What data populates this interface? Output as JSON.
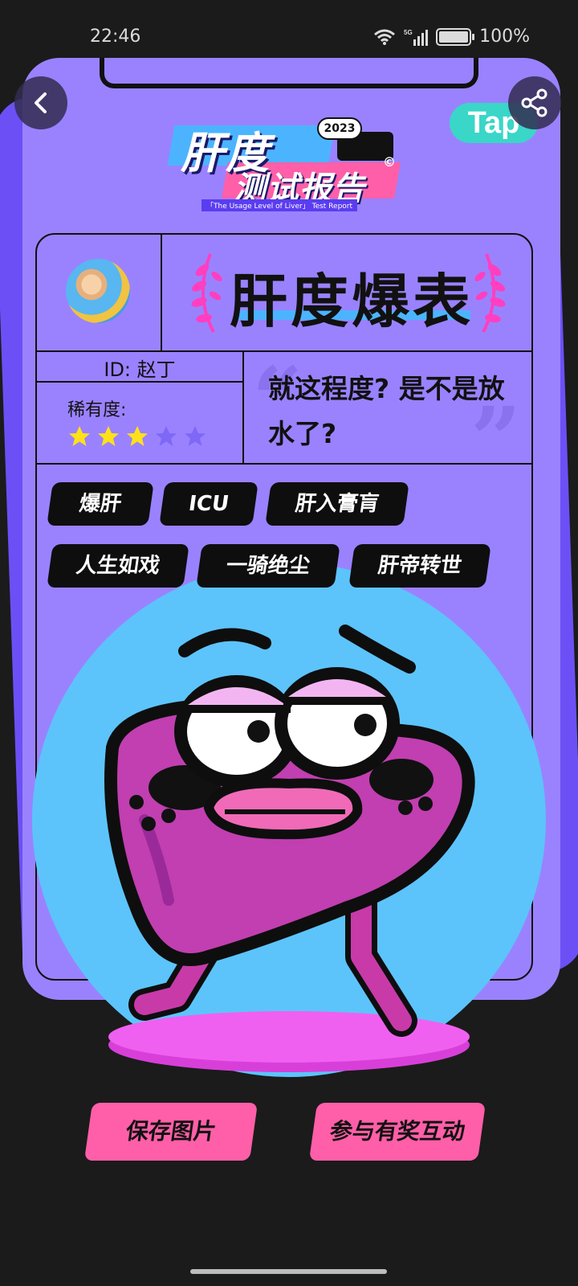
{
  "status_bar": {
    "time": "22:46",
    "battery_text": "100%",
    "network": "5G"
  },
  "header": {
    "back_icon": "chevron-left-icon",
    "share_icon": "share-icon",
    "tap_badge": "Tap"
  },
  "logo": {
    "line1": "肝度",
    "line2": "测试报告",
    "year": "2023",
    "subtitle": "「The Usage Level of Liver」 Test Report",
    "copyright": "©"
  },
  "profile": {
    "level_title": "肝度爆表",
    "user_id": "ID: 赵丁",
    "rarity_label": "稀有度:",
    "rarity_stars": 3,
    "rarity_max": 5,
    "quote": "就这程度? 是不是放水了?"
  },
  "tags": [
    {
      "label": "爆肝"
    },
    {
      "label": "ICU"
    },
    {
      "label": "肝入膏肓"
    },
    {
      "label": "人生如戏"
    },
    {
      "label": "一骑绝尘"
    },
    {
      "label": "肝帝转世"
    }
  ],
  "buttons": {
    "save": "保存图片",
    "join": "参与有奖互动"
  },
  "colors": {
    "card_bg": "#9a82ff",
    "accent_pink": "#ff5fa8",
    "accent_blue": "#4cb4ff",
    "star_yellow": "#ffe11a",
    "star_dim": "#7e68f5"
  }
}
